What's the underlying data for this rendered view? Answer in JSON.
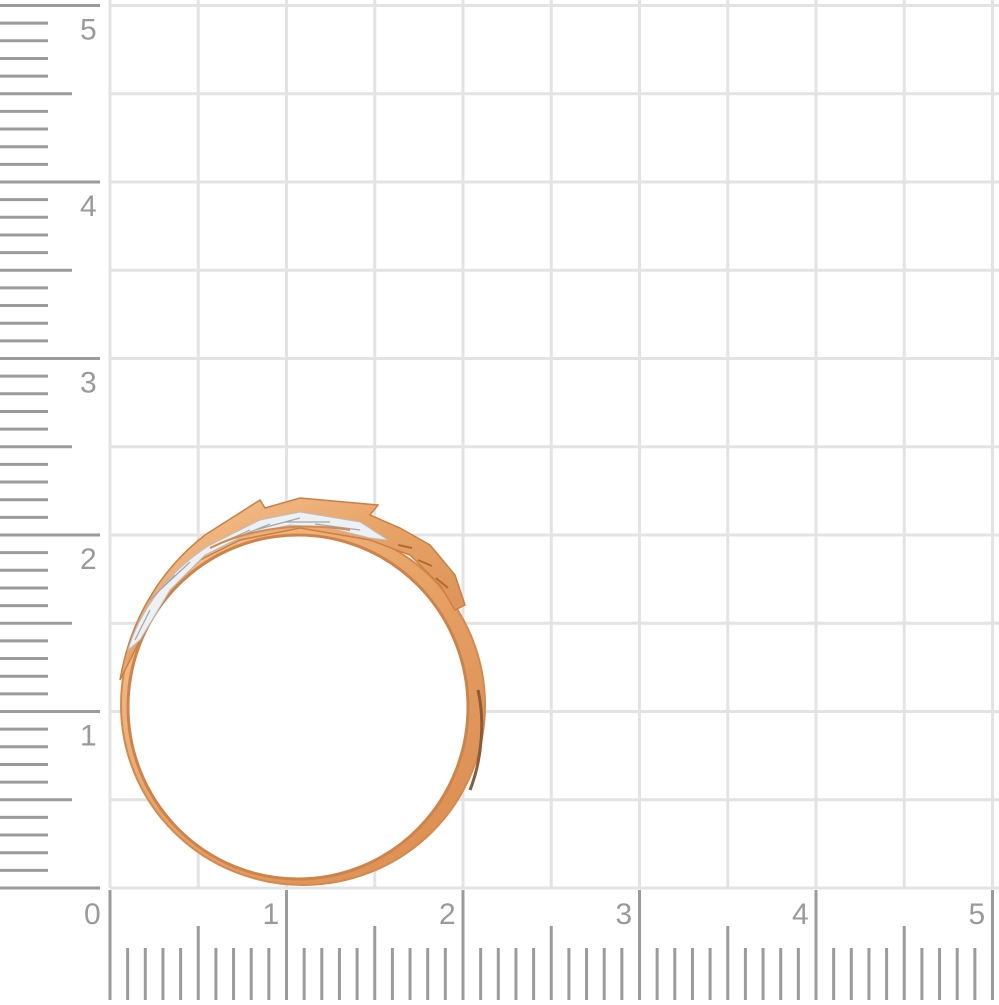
{
  "ruler": {
    "major_labels": [
      "0",
      "1",
      "2",
      "3",
      "4",
      "5"
    ],
    "unit_count": 5,
    "minor_per_unit": 10
  },
  "colors": {
    "grid": "#e3e3e3",
    "tick": "#9b9b9b",
    "label": "#9a9a9a",
    "gold": "#e8a468",
    "gold_dark": "#c97c45",
    "gold_light": "#f6c89a",
    "silver": "#eef1f3"
  },
  "objects": [
    {
      "name": "gold-ring-with-white-gold-inlay",
      "size_units": {
        "outer_width": 2.0,
        "outer_height": 2.2
      }
    }
  ]
}
